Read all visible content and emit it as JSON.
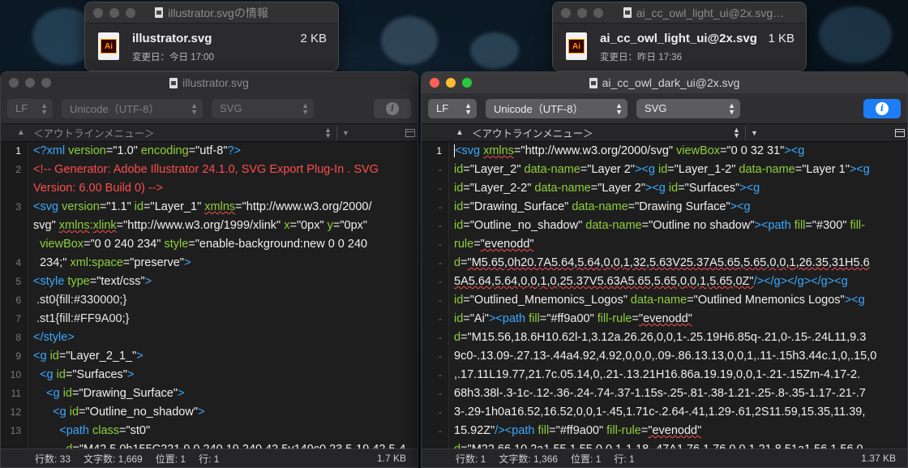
{
  "info_windows": [
    {
      "title": "illustrator.svgの情報",
      "filename": "illustrator.svg",
      "size": "2 KB",
      "modified": "変更日：今日 17:00"
    },
    {
      "title": "ai_cc_owl_light_ui@2x.svg…",
      "filename": "ai_cc_owl_light_ui@2x.svg",
      "size": "1 KB",
      "modified": "変更日：昨日 17:36"
    }
  ],
  "icons": {
    "app_icon_text": "Ai"
  },
  "editor_left": {
    "title": "illustrator.svg",
    "line_ending": "LF",
    "encoding": "Unicode（UTF-8）",
    "syntax": "SVG",
    "outline_menu": "＜アウトラインメニュー＞",
    "line_numbers": [
      "1",
      "2",
      "",
      "3",
      "",
      "",
      "4",
      "5",
      "6",
      "7",
      "8",
      "9",
      "10",
      "11",
      "12",
      "13",
      ""
    ],
    "status": {
      "lines": "行数: 33",
      "chars": "文字数: 1,669",
      "position": "位置: 1",
      "row": "行: 1",
      "size": "1.7 KB"
    }
  },
  "editor_right": {
    "title": "ai_cc_owl_dark_ui@2x.svg",
    "line_ending": "LF",
    "encoding": "Unicode（UTF-8）",
    "syntax": "SVG",
    "outline_menu": "＜アウトラインメニュー＞",
    "line_numbers": [
      "1",
      "-",
      "-",
      "-",
      "-",
      "-",
      "-",
      "-",
      "-",
      "-",
      "-",
      "-",
      "-",
      "-",
      "-",
      "-",
      "-"
    ],
    "status": {
      "lines": "行数: 1",
      "chars": "文字数: 1,366",
      "position": "位置: 1",
      "row": "行: 1",
      "size": "1.37 KB"
    }
  },
  "colors": {
    "accent": "#1d7df6",
    "tag": "#3aa9ff",
    "attr": "#8fd03c",
    "comment": "#ff4d4d"
  }
}
